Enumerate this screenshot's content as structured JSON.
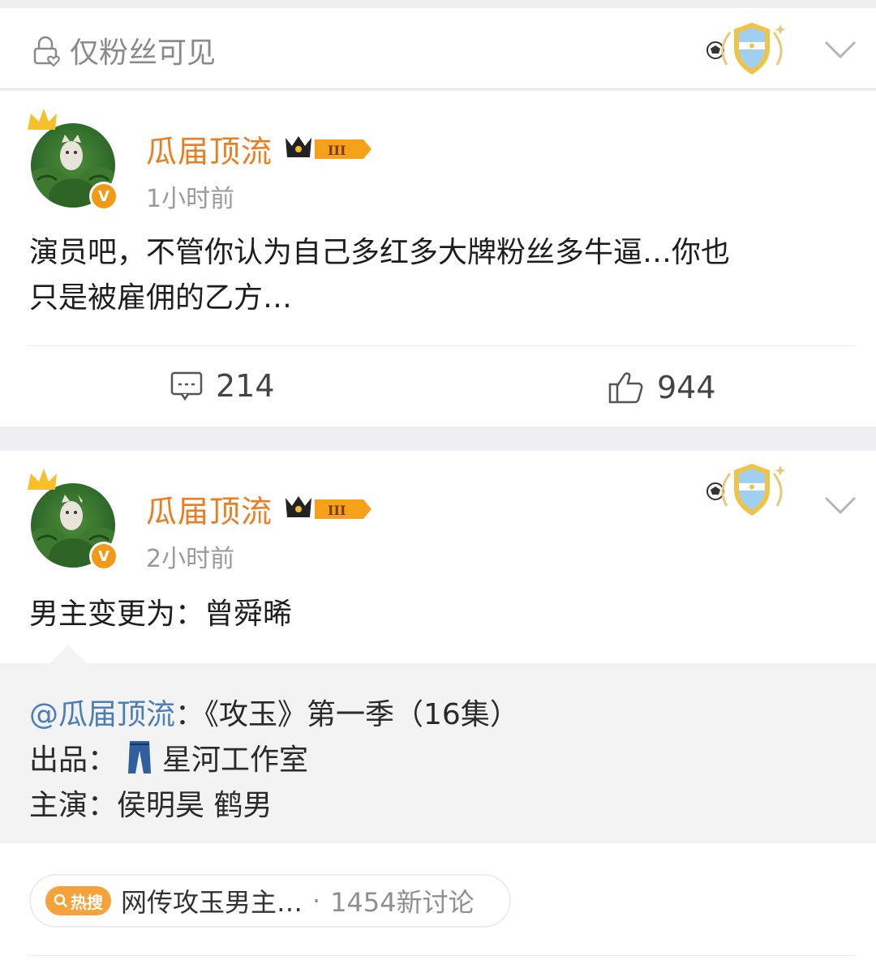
{
  "top_bar": {
    "visibility_label": "仅粉丝可见"
  },
  "posts": [
    {
      "author": "瓜届顶流",
      "vip_level": "III",
      "time": "1小时前",
      "text_line1": "演员吧，不管你认为自己多红多大牌粉丝多牛逼…你也",
      "text_line2": "只是被雇佣的乙方…",
      "comments": "214",
      "likes": "944"
    },
    {
      "author": "瓜届顶流",
      "vip_level": "III",
      "time": "2小时前",
      "text": "男主变更为：曾舜晞",
      "repost": {
        "mention": "@瓜届顶流",
        "title": "：《攻玉》第一季（16集）",
        "producer_label": "出品：",
        "producer": "星河工作室",
        "cast_label": "主演：",
        "cast": "侯明昊 鹤男"
      },
      "hot_search": {
        "tag": "热搜",
        "topic": "网传攻玉男主…",
        "separator": "·",
        "count": "1454新讨论"
      }
    }
  ],
  "colors": {
    "author_orange": "#ea7d1f",
    "mention_blue": "#4a7eb8",
    "hot_orange": "#f5a23a"
  }
}
